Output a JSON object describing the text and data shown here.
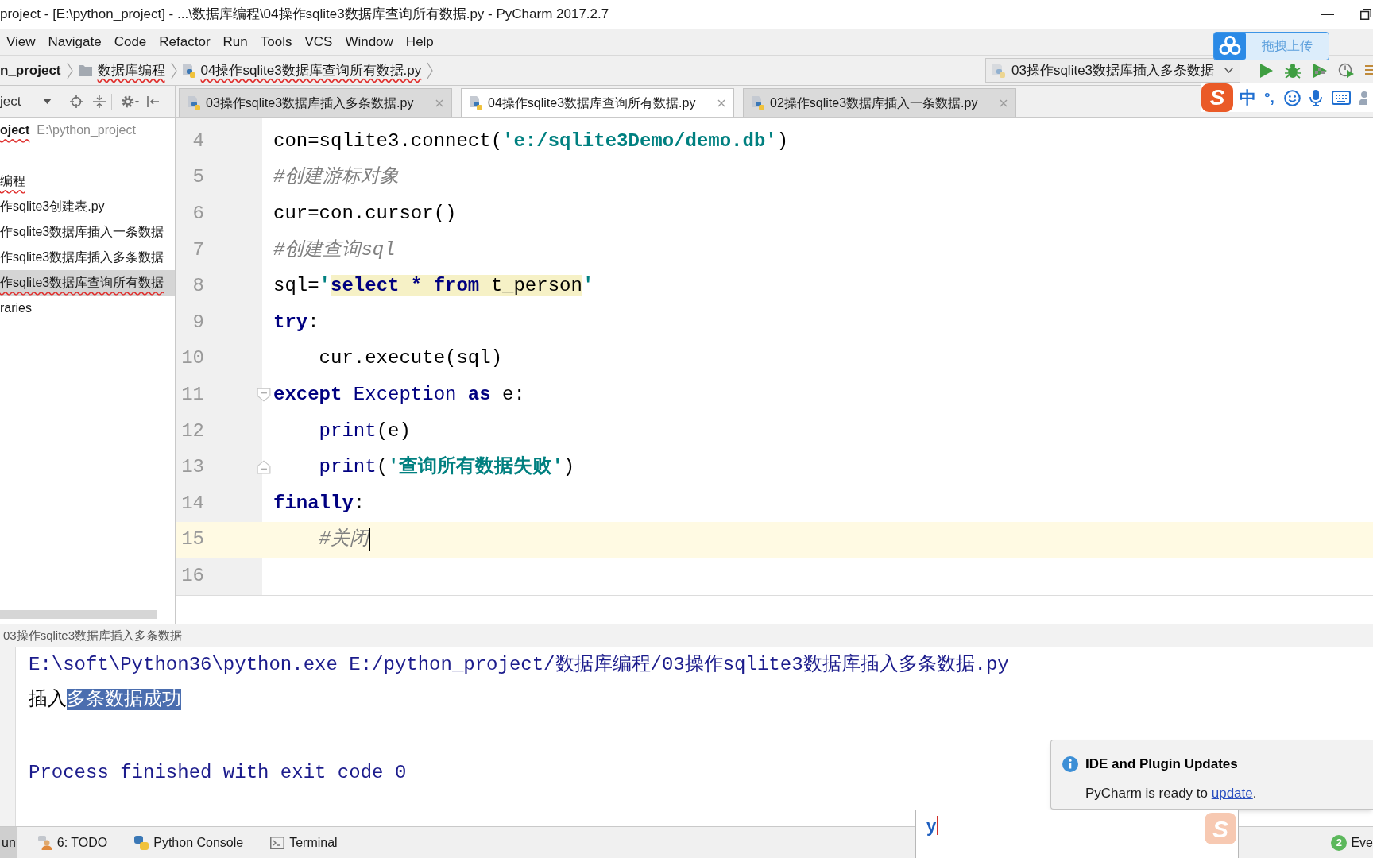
{
  "window": {
    "title": "project - [E:\\python_project] - ...\\数据库编程\\04操作sqlite3数据库查询所有数据.py - PyCharm 2017.2.7"
  },
  "menu": [
    "View",
    "Navigate",
    "Code",
    "Refactor",
    "Run",
    "Tools",
    "VCS",
    "Window",
    "Help"
  ],
  "navigation_bar": {
    "breadcrumbs": [
      {
        "kind": "project",
        "label": "n_project",
        "spell_error": false
      },
      {
        "kind": "folder",
        "label": "数据库编程",
        "spell_error": true
      },
      {
        "kind": "file",
        "label": "04操作sqlite3数据库查询所有数据.py",
        "spell_error": true
      }
    ],
    "run_configuration": "03操作sqlite3数据库插入多条数据"
  },
  "upload_overlay": {
    "label": "拖拽上传"
  },
  "ime_toolbar": {
    "logo": "S",
    "mode": "中",
    "punctuation": "°,"
  },
  "project_panel": {
    "title": "ject",
    "items": [
      {
        "kind": "root",
        "label": "oject",
        "path": "E:\\python_project",
        "selected": false,
        "spell_error": true
      },
      {
        "kind": "folder",
        "label": "编程",
        "selected": false,
        "spell_error": true
      },
      {
        "kind": "file",
        "label": "作sqlite3创建表.py",
        "selected": false,
        "spell_error": false
      },
      {
        "kind": "file",
        "label": "作sqlite3数据库插入一条数据",
        "selected": false,
        "spell_error": false
      },
      {
        "kind": "file",
        "label": "作sqlite3数据库插入多条数据",
        "selected": false,
        "spell_error": false
      },
      {
        "kind": "file",
        "label": "作sqlite3数据库查询所有数据",
        "selected": true,
        "spell_error": true
      },
      {
        "kind": "library",
        "label": "raries",
        "selected": false,
        "spell_error": false
      }
    ]
  },
  "editor_tabs": [
    {
      "label": "03操作sqlite3数据库插入多条数据.py",
      "selected": false
    },
    {
      "label": "04操作sqlite3数据库查询所有数据.py",
      "selected": true
    },
    {
      "label": "02操作sqlite3数据库插入一条数据.py",
      "selected": false
    }
  ],
  "editor": {
    "lines": [
      {
        "number": "4",
        "current": false,
        "caret": false,
        "fold_start": false,
        "fold_end": false,
        "tokens": [
          {
            "kind": "plain",
            "text": "con=sqlite3.connect("
          },
          {
            "kind": "string",
            "text": "'e:/sqlite3Demo/demo.db'"
          },
          {
            "kind": "plain",
            "text": ")"
          }
        ]
      },
      {
        "number": "5",
        "current": false,
        "caret": false,
        "fold_start": false,
        "fold_end": false,
        "tokens": [
          {
            "kind": "comment",
            "text": "#创建游标对象"
          }
        ]
      },
      {
        "number": "6",
        "current": false,
        "caret": false,
        "fold_start": false,
        "fold_end": false,
        "tokens": [
          {
            "kind": "plain",
            "text": "cur=con.cursor()"
          }
        ]
      },
      {
        "number": "7",
        "current": false,
        "caret": false,
        "fold_start": false,
        "fold_end": false,
        "tokens": [
          {
            "kind": "comment",
            "text": "#创建查询sql"
          }
        ]
      },
      {
        "number": "8",
        "current": false,
        "caret": false,
        "fold_start": false,
        "fold_end": false,
        "tokens": [
          {
            "kind": "plain",
            "text": "sql="
          },
          {
            "kind": "string",
            "text": "'"
          },
          {
            "kind": "sql_keyword",
            "text": "select * from"
          },
          {
            "kind": "sql_text",
            "text": " t_person"
          },
          {
            "kind": "string",
            "text": "'"
          }
        ]
      },
      {
        "number": "9",
        "current": false,
        "caret": false,
        "fold_start": false,
        "fold_end": false,
        "tokens": [
          {
            "kind": "keyword",
            "text": "try"
          },
          {
            "kind": "plain",
            "text": ":"
          }
        ]
      },
      {
        "number": "10",
        "current": false,
        "caret": false,
        "fold_start": false,
        "fold_end": false,
        "tokens": [
          {
            "kind": "plain",
            "text": "    cur.execute(sql)"
          }
        ]
      },
      {
        "number": "11",
        "current": false,
        "caret": false,
        "fold_start": true,
        "fold_end": false,
        "tokens": [
          {
            "kind": "keyword",
            "text": "except"
          },
          {
            "kind": "builtin",
            "text": " Exception"
          },
          {
            "kind": "keyword",
            "text": " as"
          },
          {
            "kind": "plain",
            "text": " e:"
          }
        ]
      },
      {
        "number": "12",
        "current": false,
        "caret": false,
        "fold_start": false,
        "fold_end": false,
        "tokens": [
          {
            "kind": "builtin",
            "text": "    print"
          },
          {
            "kind": "plain",
            "text": "(e)"
          }
        ]
      },
      {
        "number": "13",
        "current": false,
        "caret": false,
        "fold_start": false,
        "fold_end": true,
        "tokens": [
          {
            "kind": "builtin",
            "text": "    print"
          },
          {
            "kind": "plain",
            "text": "("
          },
          {
            "kind": "string",
            "text": "'查询所有数据失败'"
          },
          {
            "kind": "plain",
            "text": ")"
          }
        ]
      },
      {
        "number": "14",
        "current": false,
        "caret": false,
        "fold_start": false,
        "fold_end": false,
        "tokens": [
          {
            "kind": "keyword",
            "text": "finally"
          },
          {
            "kind": "plain",
            "text": ":"
          }
        ]
      },
      {
        "number": "15",
        "current": true,
        "caret": true,
        "fold_start": false,
        "fold_end": false,
        "tokens": [
          {
            "kind": "comment",
            "text": "    #关闭"
          }
        ]
      },
      {
        "number": "16",
        "current": false,
        "caret": false,
        "fold_start": false,
        "fold_end": false
      }
    ]
  },
  "run_panel": {
    "title": "03操作sqlite3数据库插入多条数据",
    "lines": [
      {
        "kind": "command",
        "segments": [
          {
            "text": "E:\\soft\\Python36\\python.exe E:/python_project/数据库编程/03操作sqlite3数据库插入多条数据.py",
            "selected": false
          }
        ]
      },
      {
        "kind": "output",
        "segments": [
          {
            "text": "插入",
            "selected": false
          },
          {
            "text": "多条数据成功",
            "selected": true
          }
        ]
      },
      {
        "kind": "system",
        "segments": [
          {
            "text": "Process finished with exit code 0",
            "selected": false
          }
        ]
      }
    ]
  },
  "notification": {
    "title": "IDE and Plugin Updates",
    "message_start": "PyCharm is ready to ",
    "link": "update",
    "message_end": "."
  },
  "ime_candidate_window": {
    "logo": "S",
    "input": "y"
  },
  "tool_window_bar": {
    "buttons": [
      {
        "kind": "run",
        "label": "un",
        "selected": true
      },
      {
        "kind": "todo",
        "label": "6: TODO",
        "selected": false
      },
      {
        "kind": "console",
        "label": "Python Console",
        "selected": false
      },
      {
        "kind": "terminal",
        "label": "Terminal",
        "selected": false
      }
    ],
    "event_log": {
      "count": "2",
      "label": "Eve"
    }
  }
}
